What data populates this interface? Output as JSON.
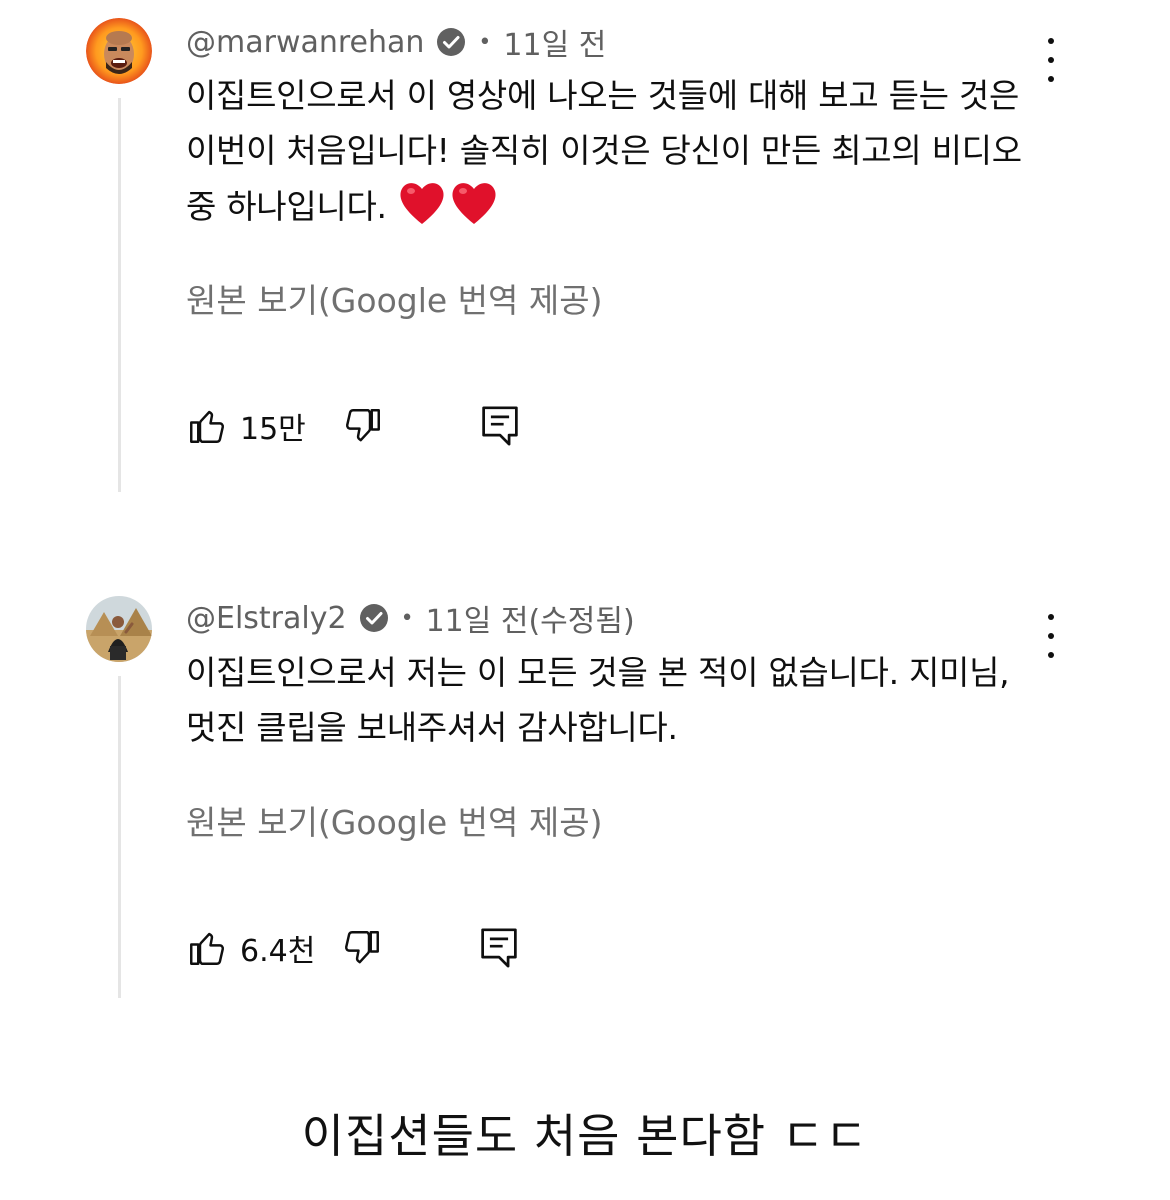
{
  "comments": [
    {
      "handle": "@marwanrehan",
      "timestamp": "11일 전",
      "text": "이집트인으로서 이 영상에 나오는 것들에 대해 보고 듣는 것은 이번이 처음입니다! 솔직히 이것은 당신이 만든 최고의 비디오 중 하나입니다.",
      "translate_label": "원본 보기(Google 번역 제공)",
      "like_count": "15만",
      "verified": true
    },
    {
      "handle": "@Elstraly2",
      "timestamp": "11일 전(수정됨)",
      "text": "이집트인으로서 저는 이 모든 것을 본 적이 없습니다. 지미님, 멋진 클립을 보내주셔서 감사합니다.",
      "translate_label": "원본 보기(Google 번역 제공)",
      "like_count": "6.4천",
      "verified": true
    }
  ],
  "caption": "이집션들도 처음 본다함 ㄷㄷ",
  "icons": {
    "more": "more-vertical-icon",
    "like": "thumbs-up-icon",
    "dislike": "thumbs-down-icon",
    "reply": "reply-comment-icon",
    "verified": "verified-check-icon",
    "hearts": "red-heart-emoji"
  },
  "colors": {
    "text_primary": "#0f0f0f",
    "text_secondary": "#606060",
    "thread_line": "#e5e5e5",
    "heart": "#e0112b"
  }
}
